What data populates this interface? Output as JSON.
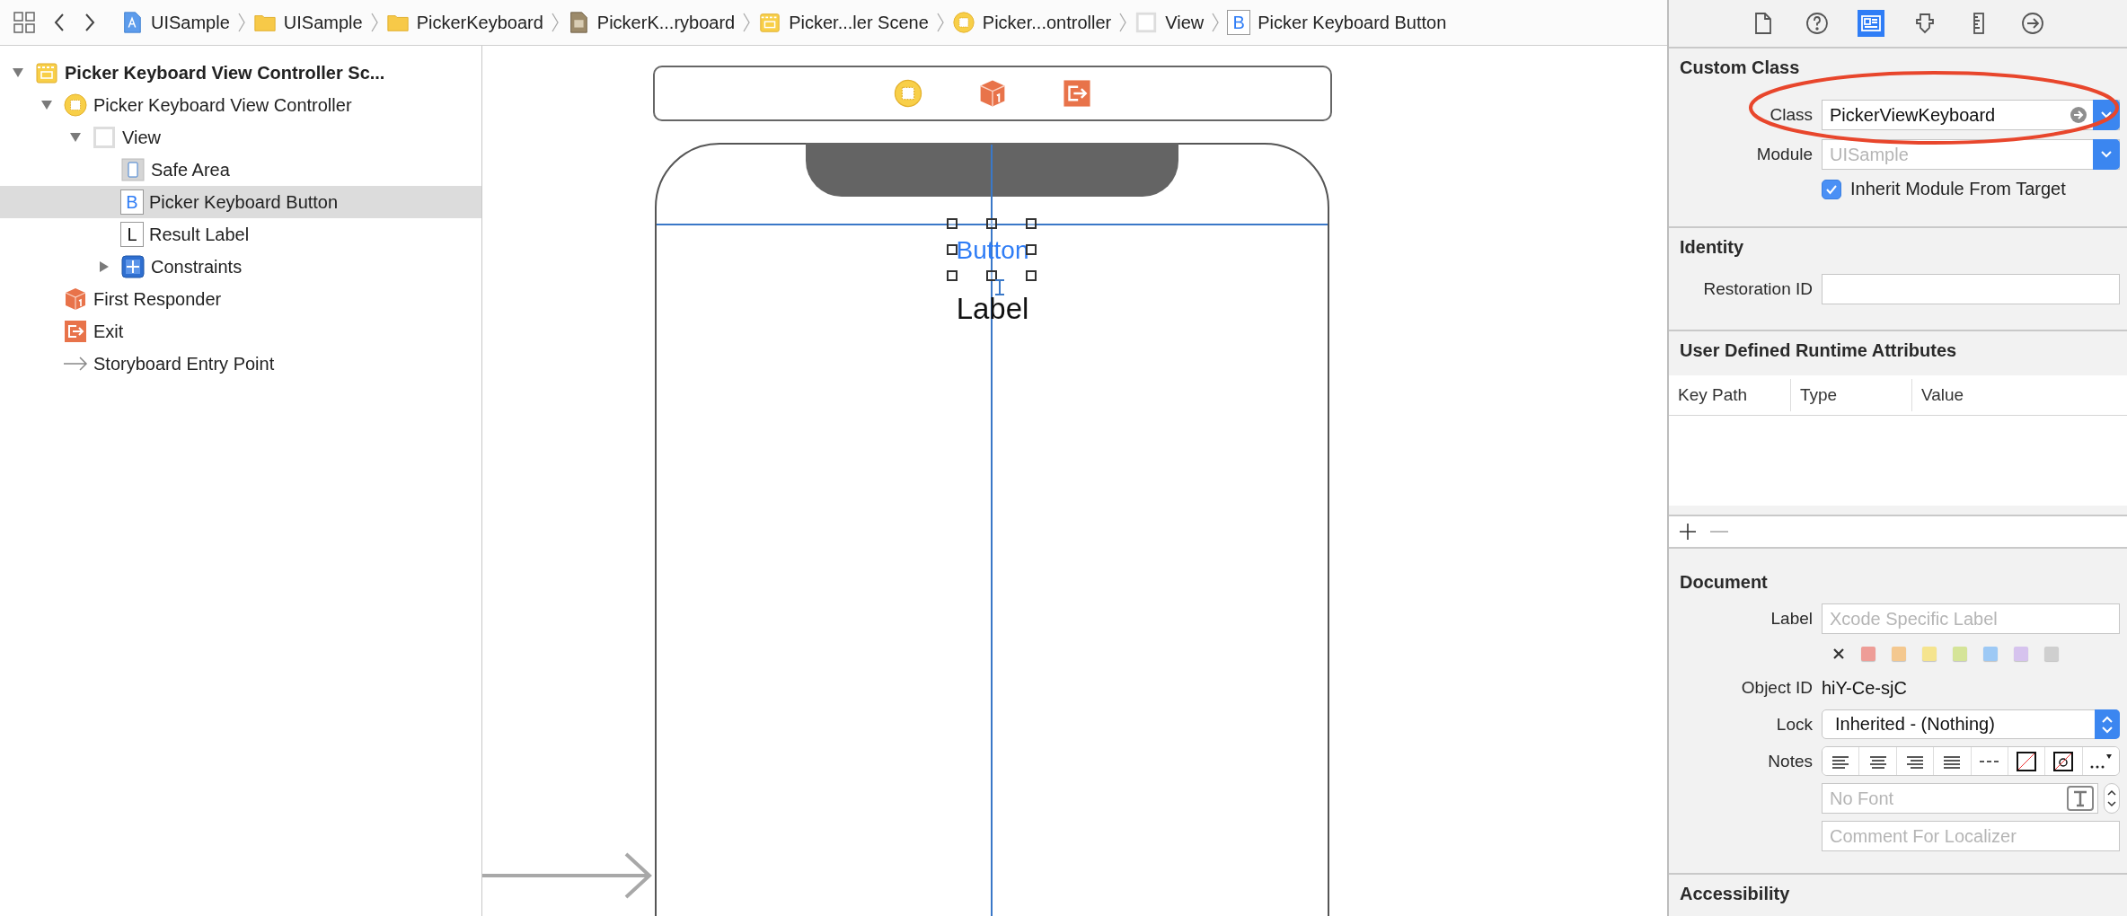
{
  "breadcrumbs": [
    {
      "label": "UISample",
      "kind": "project"
    },
    {
      "label": "UISample",
      "kind": "folder"
    },
    {
      "label": "PickerKeyboard",
      "kind": "folder"
    },
    {
      "label": "PickerK...ryboard",
      "kind": "storyboard"
    },
    {
      "label": "Picker...ler Scene",
      "kind": "scene"
    },
    {
      "label": "Picker...ontroller",
      "kind": "controller"
    },
    {
      "label": "View",
      "kind": "view"
    },
    {
      "label": "Picker Keyboard Button",
      "kind": "button",
      "glyph": "B"
    }
  ],
  "outline": {
    "items": [
      {
        "label": "Picker Keyboard View Controller Sc...",
        "kind": "scene",
        "expanded": true,
        "selected": false,
        "children": [
          {
            "label": "Picker Keyboard View Controller",
            "kind": "controller",
            "expanded": true,
            "selected": false,
            "children": [
              {
                "label": "View",
                "kind": "view",
                "expanded": true,
                "selected": false,
                "children": [
                  {
                    "label": "Safe Area",
                    "kind": "safe-area",
                    "selected": false
                  },
                  {
                    "label": "Picker Keyboard Button",
                    "kind": "button",
                    "glyph": "B",
                    "selected": true
                  },
                  {
                    "label": "Result Label",
                    "kind": "label",
                    "glyph": "L",
                    "selected": false
                  },
                  {
                    "label": "Constraints",
                    "kind": "constraints",
                    "expanded": false,
                    "selected": false
                  }
                ]
              }
            ]
          },
          {
            "label": "First Responder",
            "kind": "first-responder",
            "selected": false
          },
          {
            "label": "Exit",
            "kind": "exit",
            "selected": false
          },
          {
            "label": "Storyboard Entry Point",
            "kind": "entry-point",
            "selected": false
          }
        ]
      }
    ]
  },
  "canvas": {
    "dock_icons": [
      {
        "kind": "controller"
      },
      {
        "kind": "first-responder"
      },
      {
        "kind": "exit"
      }
    ],
    "button_text": "Button",
    "label_text": "Label"
  },
  "inspector": {
    "tabs": [
      {
        "kind": "file",
        "selected": false
      },
      {
        "kind": "help",
        "selected": false
      },
      {
        "kind": "identity",
        "selected": true
      },
      {
        "kind": "attributes",
        "selected": false
      },
      {
        "kind": "size",
        "selected": false
      },
      {
        "kind": "connections",
        "selected": false
      }
    ],
    "custom_class": {
      "title": "Custom Class",
      "class_label": "Class",
      "class_value": "PickerViewKeyboard",
      "module_label": "Module",
      "module_placeholder": "UISample",
      "inherit": {
        "label": "Inherit Module From Target",
        "checked": true
      }
    },
    "identity": {
      "title": "Identity",
      "restoration_label": "Restoration ID"
    },
    "runtime_attributes": {
      "title": "User Defined Runtime Attributes",
      "columns": [
        "Key Path",
        "Type",
        "Value"
      ]
    },
    "document": {
      "title": "Document",
      "label_label": "Label",
      "label_placeholder": "Xcode Specific Label",
      "label_colors": [
        {
          "color": "#ee9d97"
        },
        {
          "color": "#f4c88f"
        },
        {
          "color": "#f5e48e"
        },
        {
          "color": "#d5e498"
        },
        {
          "color": "#9dc9f5"
        },
        {
          "color": "#d6c3ee"
        },
        {
          "color": "#cfcfcf"
        }
      ],
      "object_id_label": "Object ID",
      "object_id": "hiY-Ce-sjC",
      "lock_label": "Lock",
      "lock_value": "Inherited - (Nothing)",
      "notes_label": "Notes",
      "font_placeholder": "No Font",
      "comment_placeholder": "Comment For Localizer"
    },
    "accessibility": {
      "title": "Accessibility"
    }
  }
}
